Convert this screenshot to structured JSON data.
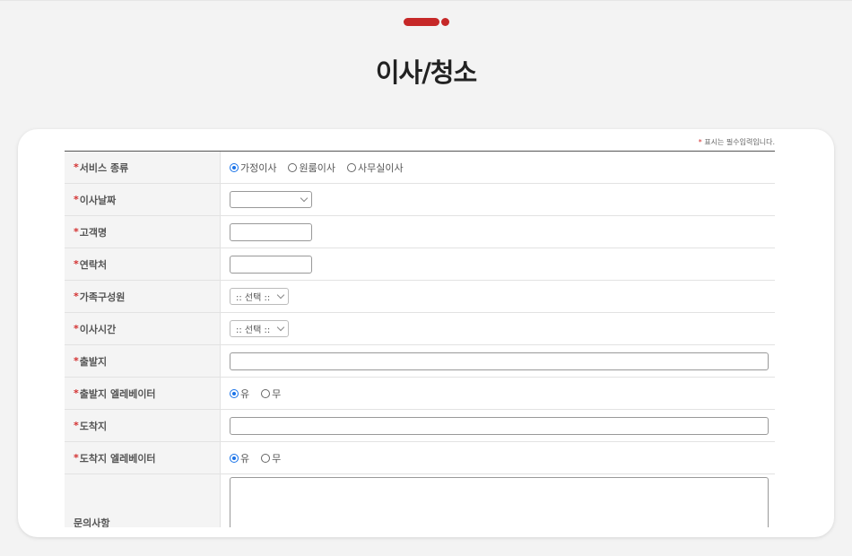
{
  "page": {
    "title": "이사/청소"
  },
  "form": {
    "required_star": "*",
    "required_note": "표시는 필수입력입니다.",
    "service_type": {
      "label": "서비스 종류",
      "options": [
        "가정이사",
        "원룸이사",
        "사무실이사"
      ],
      "selected": "가정이사"
    },
    "move_date": {
      "label": "이사날짜",
      "value": ""
    },
    "customer_name": {
      "label": "고객명",
      "value": ""
    },
    "contact": {
      "label": "연락처",
      "value": ""
    },
    "family_members": {
      "label": "가족구성원",
      "selected": ":: 선택 ::"
    },
    "move_time": {
      "label": "이사시간",
      "selected": ":: 선택 ::"
    },
    "origin": {
      "label": "출발지",
      "value": ""
    },
    "origin_elevator": {
      "label": "출발지 엘레베이터",
      "options": [
        "유",
        "무"
      ],
      "selected": "유"
    },
    "destination": {
      "label": "도착지",
      "value": ""
    },
    "destination_elevator": {
      "label": "도착지 엘레베이터",
      "options": [
        "유",
        "무"
      ],
      "selected": "유"
    },
    "inquiry": {
      "label": "문의사항",
      "value": ""
    }
  },
  "colors": {
    "accent": "#c62828",
    "required": "#d32f2f",
    "radio_selected": "#1a73e8"
  }
}
